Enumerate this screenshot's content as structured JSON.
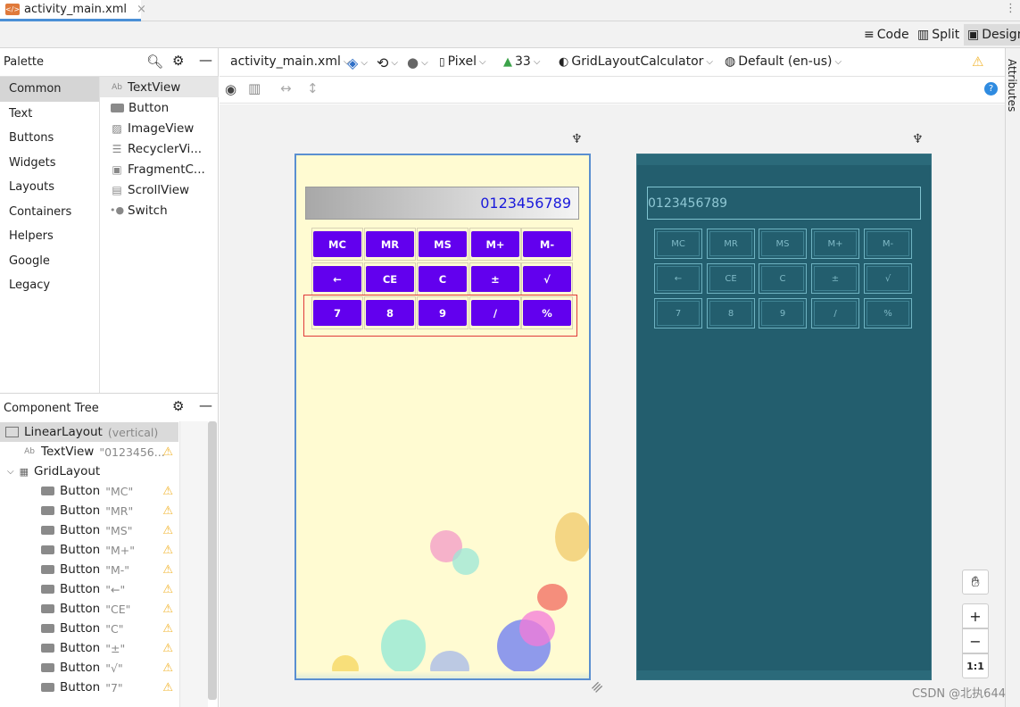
{
  "file_tab": {
    "name": "activity_main.xml",
    "close": "×"
  },
  "modes": {
    "code": "Code",
    "split": "Split",
    "design": "Design"
  },
  "palette": {
    "title": "Palette",
    "categories": [
      "Common",
      "Text",
      "Buttons",
      "Widgets",
      "Layouts",
      "Containers",
      "Helpers",
      "Google",
      "Legacy"
    ],
    "selected_category": "Common",
    "items": [
      {
        "icon": "Ab",
        "label": "TextView"
      },
      {
        "icon": "",
        "label": "Button"
      },
      {
        "icon": "",
        "label": "ImageView"
      },
      {
        "icon": "",
        "label": "RecyclerVi..."
      },
      {
        "icon": "",
        "label": "FragmentC..."
      },
      {
        "icon": "",
        "label": "ScrollView"
      },
      {
        "icon": "",
        "label": "Switch"
      }
    ]
  },
  "toolbar": {
    "file": "activity_main.xml",
    "device": "Pixel",
    "api": "33",
    "theme": "GridLayoutCalculator",
    "locale": "Default (en-us)"
  },
  "component_tree": {
    "title": "Component Tree",
    "root": {
      "label": "LinearLayout",
      "sub": "(vertical)"
    },
    "textview": {
      "label": "TextView",
      "value": "\"0123456..."
    },
    "grid": {
      "label": "GridLayout"
    },
    "buttons": [
      {
        "label": "Button",
        "value": "\"MC\""
      },
      {
        "label": "Button",
        "value": "\"MR\""
      },
      {
        "label": "Button",
        "value": "\"MS\""
      },
      {
        "label": "Button",
        "value": "\"M+\""
      },
      {
        "label": "Button",
        "value": "\"M-\""
      },
      {
        "label": "Button",
        "value": "\"←\""
      },
      {
        "label": "Button",
        "value": "\"CE\""
      },
      {
        "label": "Button",
        "value": "\"C\""
      },
      {
        "label": "Button",
        "value": "\"±\""
      },
      {
        "label": "Button",
        "value": "\"√\""
      },
      {
        "label": "Button",
        "value": "\"7\""
      }
    ]
  },
  "calculator": {
    "display": "0123456789",
    "rows": [
      [
        "MC",
        "MR",
        "MS",
        "M+",
        "M-"
      ],
      [
        "←",
        "CE",
        "C",
        "±",
        "√"
      ],
      [
        "7",
        "8",
        "9",
        "/",
        "%"
      ]
    ]
  },
  "right_panel": {
    "title": "Attributes"
  },
  "zoom": {
    "fit": "1:1",
    "plus": "+",
    "minus": "−"
  },
  "watermark": "CSDN @北执644",
  "colors": {
    "button": "#6200ee",
    "blueprint_bg": "#235e6e",
    "design_bg": "#fffbd2",
    "selection": "#e03a3a",
    "warning": "#f2b632"
  }
}
